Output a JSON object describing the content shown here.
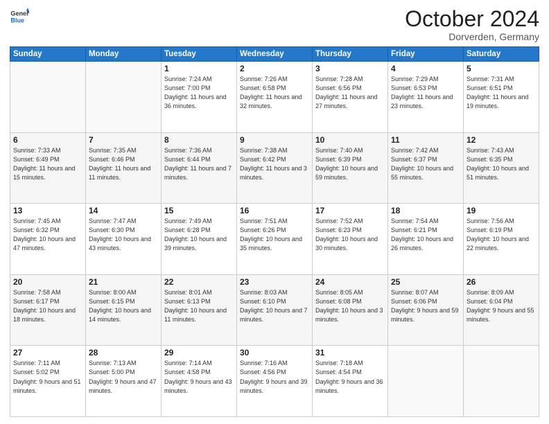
{
  "header": {
    "logo_line1": "General",
    "logo_line2": "Blue",
    "month": "October 2024",
    "location": "Dorverden, Germany"
  },
  "weekdays": [
    "Sunday",
    "Monday",
    "Tuesday",
    "Wednesday",
    "Thursday",
    "Friday",
    "Saturday"
  ],
  "weeks": [
    [
      {
        "day": "",
        "info": ""
      },
      {
        "day": "",
        "info": ""
      },
      {
        "day": "1",
        "info": "Sunrise: 7:24 AM\nSunset: 7:00 PM\nDaylight: 11 hours and 36 minutes."
      },
      {
        "day": "2",
        "info": "Sunrise: 7:26 AM\nSunset: 6:58 PM\nDaylight: 11 hours and 32 minutes."
      },
      {
        "day": "3",
        "info": "Sunrise: 7:28 AM\nSunset: 6:56 PM\nDaylight: 11 hours and 27 minutes."
      },
      {
        "day": "4",
        "info": "Sunrise: 7:29 AM\nSunset: 6:53 PM\nDaylight: 11 hours and 23 minutes."
      },
      {
        "day": "5",
        "info": "Sunrise: 7:31 AM\nSunset: 6:51 PM\nDaylight: 11 hours and 19 minutes."
      }
    ],
    [
      {
        "day": "6",
        "info": "Sunrise: 7:33 AM\nSunset: 6:49 PM\nDaylight: 11 hours and 15 minutes."
      },
      {
        "day": "7",
        "info": "Sunrise: 7:35 AM\nSunset: 6:46 PM\nDaylight: 11 hours and 11 minutes."
      },
      {
        "day": "8",
        "info": "Sunrise: 7:36 AM\nSunset: 6:44 PM\nDaylight: 11 hours and 7 minutes."
      },
      {
        "day": "9",
        "info": "Sunrise: 7:38 AM\nSunset: 6:42 PM\nDaylight: 11 hours and 3 minutes."
      },
      {
        "day": "10",
        "info": "Sunrise: 7:40 AM\nSunset: 6:39 PM\nDaylight: 10 hours and 59 minutes."
      },
      {
        "day": "11",
        "info": "Sunrise: 7:42 AM\nSunset: 6:37 PM\nDaylight: 10 hours and 55 minutes."
      },
      {
        "day": "12",
        "info": "Sunrise: 7:43 AM\nSunset: 6:35 PM\nDaylight: 10 hours and 51 minutes."
      }
    ],
    [
      {
        "day": "13",
        "info": "Sunrise: 7:45 AM\nSunset: 6:32 PM\nDaylight: 10 hours and 47 minutes."
      },
      {
        "day": "14",
        "info": "Sunrise: 7:47 AM\nSunset: 6:30 PM\nDaylight: 10 hours and 43 minutes."
      },
      {
        "day": "15",
        "info": "Sunrise: 7:49 AM\nSunset: 6:28 PM\nDaylight: 10 hours and 39 minutes."
      },
      {
        "day": "16",
        "info": "Sunrise: 7:51 AM\nSunset: 6:26 PM\nDaylight: 10 hours and 35 minutes."
      },
      {
        "day": "17",
        "info": "Sunrise: 7:52 AM\nSunset: 6:23 PM\nDaylight: 10 hours and 30 minutes."
      },
      {
        "day": "18",
        "info": "Sunrise: 7:54 AM\nSunset: 6:21 PM\nDaylight: 10 hours and 26 minutes."
      },
      {
        "day": "19",
        "info": "Sunrise: 7:56 AM\nSunset: 6:19 PM\nDaylight: 10 hours and 22 minutes."
      }
    ],
    [
      {
        "day": "20",
        "info": "Sunrise: 7:58 AM\nSunset: 6:17 PM\nDaylight: 10 hours and 18 minutes."
      },
      {
        "day": "21",
        "info": "Sunrise: 8:00 AM\nSunset: 6:15 PM\nDaylight: 10 hours and 14 minutes."
      },
      {
        "day": "22",
        "info": "Sunrise: 8:01 AM\nSunset: 6:13 PM\nDaylight: 10 hours and 11 minutes."
      },
      {
        "day": "23",
        "info": "Sunrise: 8:03 AM\nSunset: 6:10 PM\nDaylight: 10 hours and 7 minutes."
      },
      {
        "day": "24",
        "info": "Sunrise: 8:05 AM\nSunset: 6:08 PM\nDaylight: 10 hours and 3 minutes."
      },
      {
        "day": "25",
        "info": "Sunrise: 8:07 AM\nSunset: 6:06 PM\nDaylight: 9 hours and 59 minutes."
      },
      {
        "day": "26",
        "info": "Sunrise: 8:09 AM\nSunset: 6:04 PM\nDaylight: 9 hours and 55 minutes."
      }
    ],
    [
      {
        "day": "27",
        "info": "Sunrise: 7:11 AM\nSunset: 5:02 PM\nDaylight: 9 hours and 51 minutes."
      },
      {
        "day": "28",
        "info": "Sunrise: 7:13 AM\nSunset: 5:00 PM\nDaylight: 9 hours and 47 minutes."
      },
      {
        "day": "29",
        "info": "Sunrise: 7:14 AM\nSunset: 4:58 PM\nDaylight: 9 hours and 43 minutes."
      },
      {
        "day": "30",
        "info": "Sunrise: 7:16 AM\nSunset: 4:56 PM\nDaylight: 9 hours and 39 minutes."
      },
      {
        "day": "31",
        "info": "Sunrise: 7:18 AM\nSunset: 4:54 PM\nDaylight: 9 hours and 36 minutes."
      },
      {
        "day": "",
        "info": ""
      },
      {
        "day": "",
        "info": ""
      }
    ]
  ]
}
